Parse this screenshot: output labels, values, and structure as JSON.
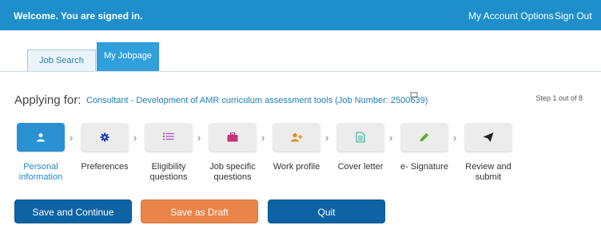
{
  "header": {
    "welcome": "Welcome. You are signed in.",
    "account_options": "My Account Options",
    "sign_out": "Sign Out"
  },
  "tabs": [
    {
      "label": "Job Search"
    },
    {
      "label": "My Jobpage"
    }
  ],
  "application": {
    "applying_for_label": "Applying for:",
    "job_title": "Consultant - Development of AMR curriculum assessment tools (Job Number: 2500639)",
    "step_count": "Step 1 out of 8"
  },
  "steps": [
    {
      "label": "Personal information",
      "icon": "person-icon",
      "color": "#ffffff"
    },
    {
      "label": "Preferences",
      "icon": "gear-icon",
      "color": "#1f3fb6"
    },
    {
      "label": "Eligibility questions",
      "icon": "list-icon",
      "color": "#b25bc4"
    },
    {
      "label": "Job specific questions",
      "icon": "briefcase-icon",
      "color": "#c2347a"
    },
    {
      "label": "Work profile",
      "icon": "person-add-icon",
      "color": "#e08b25"
    },
    {
      "label": "Cover letter",
      "icon": "document-icon",
      "color": "#38b3a6"
    },
    {
      "label": "e- Signature",
      "icon": "pencil-icon",
      "color": "#5ab02e"
    },
    {
      "label": "Review and submit",
      "icon": "send-icon",
      "color": "#222222"
    }
  ],
  "buttons": {
    "save_continue": "Save and Continue",
    "save_draft": "Save as Draft",
    "quit": "Quit"
  }
}
